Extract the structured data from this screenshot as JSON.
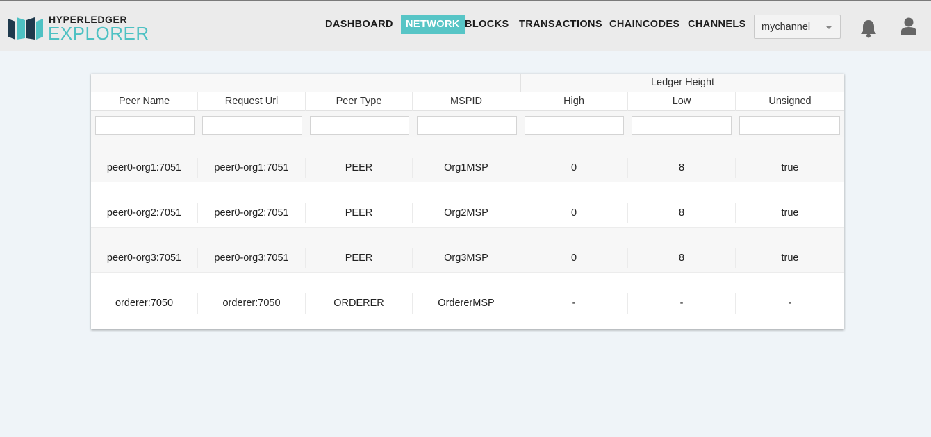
{
  "brand": {
    "line1": "HYPERLEDGER",
    "line2": "EXPLORER",
    "accent": "#57c5c6"
  },
  "nav": {
    "items": [
      {
        "label": "DASHBOARD",
        "active": false
      },
      {
        "label": "NETWORK",
        "active": true
      },
      {
        "label": "BLOCKS",
        "active": false
      },
      {
        "label": "TRANSACTIONS",
        "active": false
      },
      {
        "label": "CHAINCODES",
        "active": false
      },
      {
        "label": "CHANNELS",
        "active": false
      }
    ]
  },
  "channel_select": {
    "value": "mychannel"
  },
  "icons": {
    "notifications": "bell-icon",
    "profile": "user-icon"
  },
  "table": {
    "group_header": "Ledger Height",
    "columns": [
      "Peer Name",
      "Request Url",
      "Peer Type",
      "MSPID",
      "High",
      "Low",
      "Unsigned"
    ],
    "rows": [
      [
        "peer0-org1:7051",
        "peer0-org1:7051",
        "PEER",
        "Org1MSP",
        "0",
        "8",
        "true"
      ],
      [
        "peer0-org2:7051",
        "peer0-org2:7051",
        "PEER",
        "Org2MSP",
        "0",
        "8",
        "true"
      ],
      [
        "peer0-org3:7051",
        "peer0-org3:7051",
        "PEER",
        "Org3MSP",
        "0",
        "8",
        "true"
      ],
      [
        "orderer:7050",
        "orderer:7050",
        "ORDERER",
        "OrdererMSP",
        "-",
        "-",
        "-"
      ]
    ]
  }
}
